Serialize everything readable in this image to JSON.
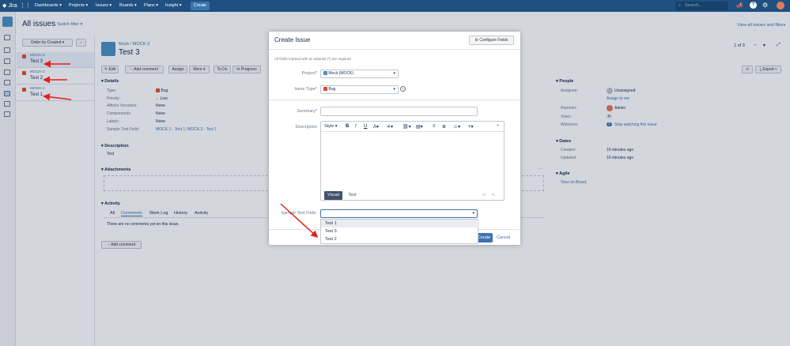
{
  "topnav": {
    "logo": "Jira",
    "menu": [
      "Dashboards",
      "Projects",
      "Issues",
      "Boards",
      "Plans",
      "Insight"
    ],
    "create_label": "Create",
    "search_placeholder": "Search..."
  },
  "header": {
    "title": "All issues",
    "switch_filter": "Switch filter",
    "view_all": "View all issues and filters",
    "sort_label": "Order by Created",
    "pager": "1 of 3"
  },
  "issues": [
    {
      "key": "MOCK-3",
      "summary": "Test 3"
    },
    {
      "key": "MOCK-2",
      "summary": "Test 2"
    },
    {
      "key": "MOCK-1",
      "summary": "Test 1"
    }
  ],
  "issue": {
    "breadcrumb_project": "Mock",
    "breadcrumb_key": "MOCK-3",
    "title": "Test 3",
    "toolbar": [
      "Edit",
      "Add comment",
      "Assign",
      "More",
      "To Do",
      "In Progress"
    ],
    "export_label": "Export",
    "details_heading": "Details",
    "details": [
      {
        "label": "Type:",
        "value": "Bug"
      },
      {
        "label": "Priority:",
        "value": "Low"
      },
      {
        "label": "Affects Version/s:",
        "value": "None"
      },
      {
        "label": "Component/s:",
        "value": "None"
      },
      {
        "label": "Labels:",
        "value": "None"
      },
      {
        "label": "Sample Test Field:",
        "value": "MOCK-1 - Test 1; MOCK-2 - Test 1"
      }
    ],
    "description_heading": "Description",
    "description": "Test",
    "attachments_heading": "Attachments",
    "activity_heading": "Activity",
    "activity_tabs": [
      "All",
      "Comments",
      "Work Log",
      "History",
      "Activity"
    ],
    "no_comments": "There are no comments yet on this issue.",
    "add_comment": "Add comment",
    "people_heading": "People",
    "assignee_label": "Assignee:",
    "assignee_value": "Unassigned",
    "assign_to_me": "Assign to me",
    "reporter_label": "Reporter:",
    "reporter_value": "Admin",
    "votes_label": "Votes:",
    "votes_value": "0",
    "watchers_label": "Watchers:",
    "watchers_count": "1",
    "watchers_link": "Stop watching this issue",
    "dates_heading": "Dates",
    "created_label": "Created:",
    "created_value": "10 minutes ago",
    "updated_label": "Updated:",
    "updated_value": "10 minutes ago",
    "agile_heading": "Agile",
    "view_on_board": "View on Board"
  },
  "dialog": {
    "title": "Create Issue",
    "configure_fields": "Configure Fields",
    "required_note": "All fields marked with an asterisk (*) are required",
    "project_label": "Project*",
    "project_value": "Mock (MOCK)",
    "issue_type_label": "Issue Type*",
    "issue_type_value": "Bug",
    "summary_label": "Summary*",
    "description_label": "Description",
    "style_label": "Style",
    "visual_tab": "Visual",
    "text_tab": "Text",
    "sample_field_label": "Sample Test Field",
    "options": [
      "Test 1",
      "Test 3",
      "Test 2"
    ],
    "create_button": "Create",
    "cancel_link": "Cancel"
  },
  "colors": {
    "topnav": "#205081",
    "accent": "#3b73af",
    "arrow": "#e5201a"
  }
}
